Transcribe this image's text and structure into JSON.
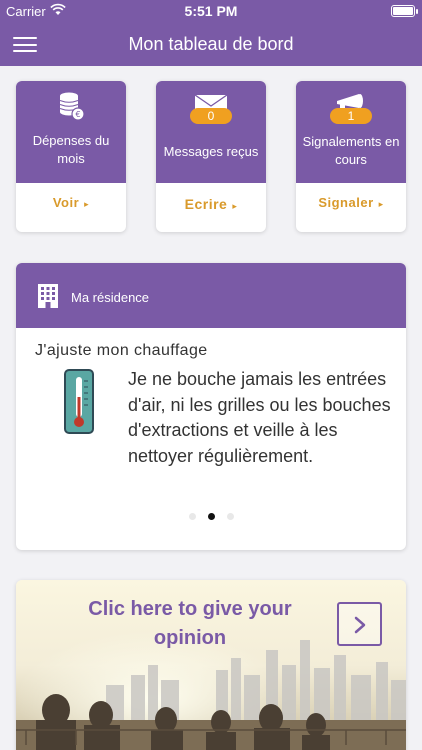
{
  "status_bar": {
    "carrier": "Carrier",
    "time": "5:51 PM"
  },
  "nav": {
    "title": "Mon tableau de bord",
    "menu_icon": "hamburger-menu-icon"
  },
  "cards": [
    {
      "label": "Dépenses du mois",
      "action": "Voir",
      "icon": "coins-icon"
    },
    {
      "label": "Messages reçus",
      "badge": "0",
      "action": "Ecrire",
      "icon": "envelope-icon"
    },
    {
      "label": "Signalements en cours",
      "badge": "1",
      "action": "Signaler",
      "icon": "megaphone-icon"
    }
  ],
  "residence": {
    "header": "Ma résidence",
    "tip_title": "J'ajuste mon chauffage",
    "tip_text": "Je ne bouche jamais les entrées d'air, ni les grilles ou les bouches d'extractions et veille à les nettoyer régulièrement.",
    "page_count": 3,
    "active_page": 2
  },
  "banner": {
    "text": "Clic here to give your opinion"
  },
  "colors": {
    "primary": "#7a5aa6",
    "accent": "#f0a020",
    "action_text": "#d99a2b"
  }
}
